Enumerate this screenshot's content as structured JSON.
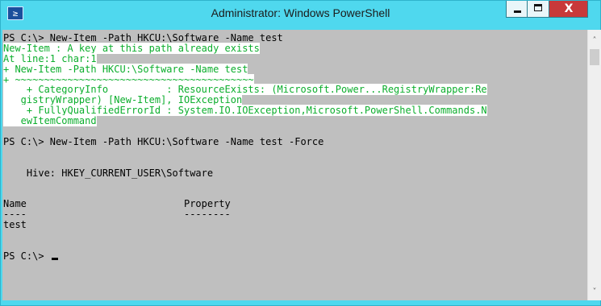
{
  "window": {
    "title": "Administrator: Windows PowerShell",
    "icon": "powershell-icon",
    "icon_glyph": "≥",
    "accent_color": "#4fd8ee",
    "close_color": "#c8393a"
  },
  "console": {
    "background": "#bfbfbf",
    "error_foreground": "#0cae2d",
    "lines": [
      {
        "text": "PS C:\\> New-Item -Path HKCU:\\Software -Name test",
        "error": false
      },
      {
        "text": "New-Item : A key at this path already exists",
        "error": true
      },
      {
        "text": "At line:1 char:1",
        "error": true
      },
      {
        "text": "+ New-Item -Path HKCU:\\Software -Name test",
        "error": true
      },
      {
        "text": "+ ~~~~~~~~~~~~~~~~~~~~~~~~~~~~~~~~~~~~~~~~~",
        "error": true
      },
      {
        "text": "    + CategoryInfo          : ResourceExists: (Microsoft.Power...RegistryWrapper:Re",
        "error": true
      },
      {
        "text": "   gistryWrapper) [New-Item], IOException",
        "error": true
      },
      {
        "text": "    + FullyQualifiedErrorId : System.IO.IOException,Microsoft.PowerShell.Commands.N",
        "error": true
      },
      {
        "text": "   ewItemCommand",
        "error": true
      },
      {
        "text": "",
        "error": false
      },
      {
        "text": "PS C:\\> New-Item -Path HKCU:\\Software -Name test -Force",
        "error": false
      },
      {
        "text": "",
        "error": false
      },
      {
        "text": "",
        "error": false
      },
      {
        "text": "    Hive: HKEY_CURRENT_USER\\Software",
        "error": false
      },
      {
        "text": "",
        "error": false
      },
      {
        "text": "",
        "error": false
      },
      {
        "text": "Name                           Property",
        "error": false
      },
      {
        "text": "----                           --------",
        "error": false
      },
      {
        "text": "test",
        "error": false
      },
      {
        "text": "",
        "error": false
      },
      {
        "text": "",
        "error": false
      },
      {
        "text": "PS C:\\> ",
        "error": false,
        "cursor": true
      }
    ]
  },
  "scrollbar": {
    "up_arrow": "˄",
    "down_arrow": "˅"
  }
}
